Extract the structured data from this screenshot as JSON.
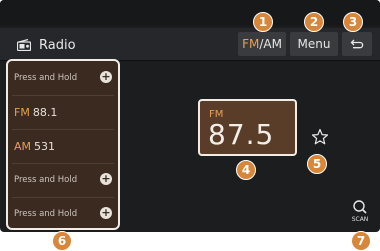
{
  "header": {
    "title": "Radio",
    "fm_am_band_fm": "FM",
    "fm_am_separator": "/",
    "fm_am_band_am": "AM",
    "menu_label": "Menu"
  },
  "presets": [
    {
      "type": "hold",
      "label": "Press and Hold"
    },
    {
      "type": "station",
      "band": "FM",
      "freq": "88.1"
    },
    {
      "type": "station",
      "band": "AM",
      "freq": "531"
    },
    {
      "type": "hold",
      "label": "Press and Hold"
    },
    {
      "type": "hold",
      "label": "Press and Hold"
    }
  ],
  "current": {
    "band": "FM",
    "frequency": "87.5"
  },
  "scan_label": "SCAN",
  "callouts": [
    "1",
    "2",
    "3",
    "4",
    "5",
    "6",
    "7"
  ],
  "colors": {
    "accent": "#e7a055",
    "badge": "#d8873a",
    "screen_bg": "#1c1d1f",
    "preset_bg": "#3a2a20",
    "freq_box_bg": "#5a3d29"
  },
  "icons": {
    "title": "radio-icon",
    "back": "back-arrow-icon",
    "favorite": "star-outline-icon",
    "scan": "scan-icon",
    "add": "plus-icon"
  }
}
